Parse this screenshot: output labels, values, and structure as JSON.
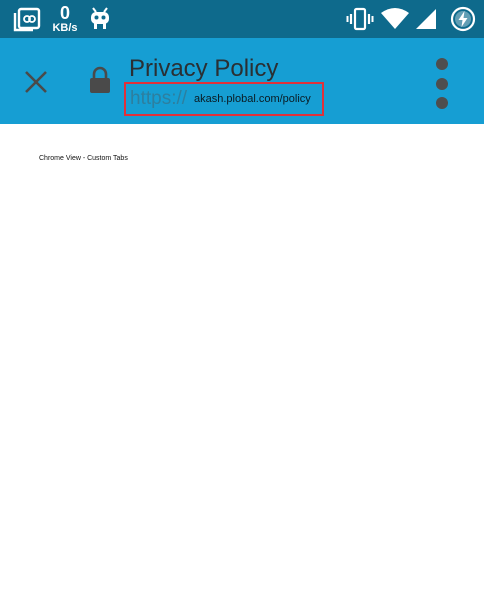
{
  "status_bar": {
    "net_speed_value": "0",
    "net_speed_unit": "KB/s",
    "icons": [
      "gallery-icon",
      "android-icon",
      "vibrate-icon",
      "wifi-icon",
      "signal-icon",
      "battery-charging-icon"
    ]
  },
  "toolbar": {
    "title": "Privacy Policy",
    "url_scheme": "https://",
    "url_host": "akash.plobal.com/policy",
    "close_icon": "close-icon",
    "lock_icon": "lock-icon",
    "menu_icon": "overflow-menu-icon"
  },
  "page": {
    "body_text": "Chrome View - Custom Tabs"
  },
  "colors": {
    "status_bar": "#0e6a8c",
    "toolbar": "#169ed3",
    "highlight_border": "#e0313a",
    "url_scheme": "#2d7f9f"
  }
}
